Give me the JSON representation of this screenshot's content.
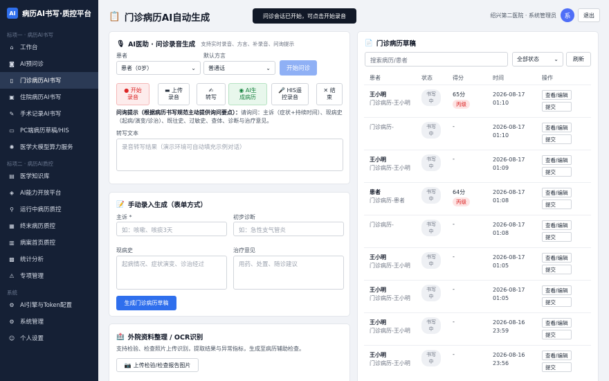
{
  "app": {
    "logo": "AI",
    "title": "病历AI书写·质控平台"
  },
  "sidebar": {
    "sections": [
      {
        "title": "标项一 · 病历AI书写",
        "items": [
          {
            "icon": "⌂",
            "label": "工作台",
            "active": false
          },
          {
            "icon": "◙",
            "label": "AI预问诊",
            "active": false
          },
          {
            "icon": "▯",
            "label": "门诊病历AI书写",
            "active": true
          },
          {
            "icon": "▣",
            "label": "住院病历AI书写",
            "active": false
          },
          {
            "icon": "✎",
            "label": "手术记录AI书写",
            "active": false
          },
          {
            "icon": "▭",
            "label": "PC端病历草稿/HIS",
            "active": false
          },
          {
            "icon": "✺",
            "label": "医学大模型算力服务",
            "active": false
          }
        ]
      },
      {
        "title": "标项二 · 病历AI质控",
        "items": [
          {
            "icon": "▤",
            "label": "医学知识库",
            "active": false
          },
          {
            "icon": "◈",
            "label": "AI能力开放平台",
            "active": false
          },
          {
            "icon": "⚲",
            "label": "运行中病历质控",
            "active": false
          },
          {
            "icon": "▦",
            "label": "终末病历质控",
            "active": false
          },
          {
            "icon": "▥",
            "label": "病案首页质控",
            "active": false
          },
          {
            "icon": "▩",
            "label": "统计分析",
            "active": false
          },
          {
            "icon": "⚠",
            "label": "专项管理",
            "active": false
          }
        ]
      },
      {
        "title": "系统",
        "items": [
          {
            "icon": "⚙",
            "label": "AI引擎与Token配置",
            "active": false
          },
          {
            "icon": "⚙",
            "label": "系统管理",
            "active": false
          },
          {
            "icon": "☺",
            "label": "个人设置",
            "active": false
          }
        ]
      }
    ]
  },
  "header": {
    "title": "门诊病历AI自动生成",
    "toast": "问诊会话已开始，可点击开始录音",
    "user": "绍兴第二医院 · 系统管理员",
    "avatar": "系",
    "logout": "退出"
  },
  "consult": {
    "title": "AI医助 · 问诊录音生成",
    "subtitle": "支持实时录音、方言、补录音、问询提示",
    "patient_label": "患者",
    "patient_value": "患者（0岁）",
    "dialect_label": "默认方言",
    "dialect_value": "普通话",
    "start_btn": "开始问诊",
    "tools": [
      {
        "icon": "●",
        "l1": "开始",
        "l2": "录音",
        "style": "red"
      },
      {
        "icon": "▬",
        "l1": "上传",
        "l2": "录音",
        "style": ""
      },
      {
        "icon": "✍",
        "l1": "",
        "l2": "转写",
        "style": ""
      },
      {
        "icon": "◉",
        "l1": "AI生",
        "l2": "成病历",
        "style": "green"
      },
      {
        "icon": "🎤",
        "l1": "HIS遥",
        "l2": "控录音",
        "style": ""
      },
      {
        "icon": "✕",
        "l1": "结",
        "l2": "束",
        "style": ""
      }
    ],
    "hint_title": "问询提示（根据病历书写规范主动提供询问要点）：",
    "hint_text": "请询问：主诉（症状+持续时间）、现病史（起病/演变/诊治）、既往史、过敏史、查体、诊断与治疗意见。",
    "transcript_label": "转写文本",
    "transcript_placeholder": "录音转写结果（演示环境可自动填充示例对话）"
  },
  "manual": {
    "title": "手动录入生成（表单方式）",
    "complaint_label": "主诉 *",
    "complaint_placeholder": "如：咳嗽、咳痰3天",
    "diagnosis_label": "初步诊断",
    "diagnosis_placeholder": "如：急性支气管炎",
    "history_label": "现病史",
    "history_placeholder": "起病情况、症状演变、诊治经过",
    "treatment_label": "治疗意见",
    "treatment_placeholder": "用药、处置、随诊建议",
    "generate_btn": "生成门诊病历草稿"
  },
  "ocr": {
    "title": "外院资料整理 / OCR识别",
    "desc": "支持检验、检查照片上传识别，提取结果与异常指标，生成至病历辅助检查。",
    "upload_btn": "上传检验/检查报告图片"
  },
  "drafts": {
    "title": "门诊病历草稿",
    "search_placeholder": "搜索病历/患者",
    "status_filter": "全部状态",
    "refresh": "刷新",
    "columns": {
      "patient": "患者",
      "status": "状态",
      "score": "得分",
      "time": "时间",
      "ops": "操作"
    },
    "op_view": "查看/编辑",
    "op_submit": "提交",
    "rows": [
      {
        "name": "王小明",
        "desc": "门诊病历-王小明",
        "s1": "书写",
        "s2": "中",
        "score": "65分",
        "grade": "丙级",
        "date": "2026-08-17",
        "clock": "01:10"
      },
      {
        "name": "",
        "desc": "门诊病历-",
        "s1": "书写",
        "s2": "中",
        "score": "-",
        "grade": "",
        "date": "2026-08-17",
        "clock": "01:10"
      },
      {
        "name": "王小明",
        "desc": "门诊病历-王小明",
        "s1": "书写",
        "s2": "中",
        "score": "-",
        "grade": "",
        "date": "2026-08-17",
        "clock": "01:09"
      },
      {
        "name": "患者",
        "desc": "门诊病历-患者",
        "s1": "书写",
        "s2": "中",
        "score": "64分",
        "grade": "丙级",
        "date": "2026-08-17",
        "clock": "01:08"
      },
      {
        "name": "",
        "desc": "门诊病历-",
        "s1": "书写",
        "s2": "中",
        "score": "-",
        "grade": "",
        "date": "2026-08-17",
        "clock": "01:08"
      },
      {
        "name": "王小明",
        "desc": "门诊病历-王小明",
        "s1": "书写",
        "s2": "中",
        "score": "-",
        "grade": "",
        "date": "2026-08-17",
        "clock": "01:05"
      },
      {
        "name": "王小明",
        "desc": "门诊病历-王小明",
        "s1": "书写",
        "s2": "中",
        "score": "-",
        "grade": "",
        "date": "2026-08-17",
        "clock": "01:05"
      },
      {
        "name": "王小明",
        "desc": "门诊病历-王小明",
        "s1": "书写",
        "s2": "中",
        "score": "-",
        "grade": "",
        "date": "2026-08-16",
        "clock": "23:59"
      },
      {
        "name": "王小明",
        "desc": "门诊病历-王小明",
        "s1": "书写",
        "s2": "中",
        "score": "-",
        "grade": "",
        "date": "2026-08-16",
        "clock": "23:56"
      }
    ]
  }
}
